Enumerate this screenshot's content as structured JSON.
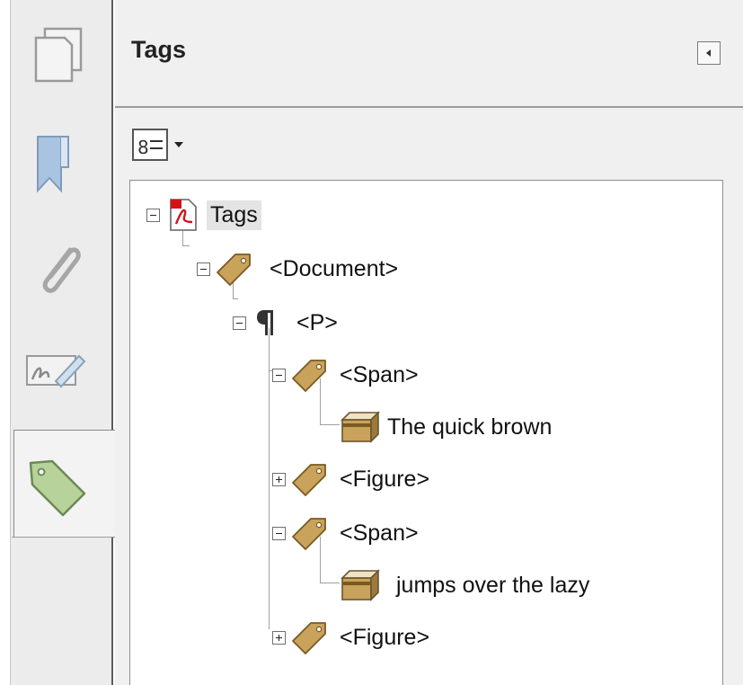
{
  "sidebar": {
    "items": [
      {
        "name": "pages",
        "icon": "pages-icon"
      },
      {
        "name": "bookmarks",
        "icon": "bookmark-icon"
      },
      {
        "name": "attachments",
        "icon": "paperclip-icon"
      },
      {
        "name": "signatures",
        "icon": "signature-icon"
      },
      {
        "name": "tags",
        "icon": "tag-icon",
        "active": true
      }
    ]
  },
  "panel": {
    "title": "Tags",
    "collapse_icon": "collapse-left-icon",
    "options_icon": "options-menu-icon"
  },
  "tree": {
    "nodes": [
      {
        "label": "Tags",
        "icon": "pdf-file-icon",
        "expander": "minus",
        "selected": true
      },
      {
        "label": "<Document>",
        "icon": "tag-icon",
        "expander": "minus"
      },
      {
        "label": "<P>",
        "icon": "paragraph-icon",
        "expander": "minus"
      },
      {
        "label": "<Span>",
        "icon": "tag-icon",
        "expander": "minus"
      },
      {
        "label": "The quick brown",
        "icon": "content-box-icon",
        "expander": "none"
      },
      {
        "label": "<Figure>",
        "icon": "tag-icon",
        "expander": "plus"
      },
      {
        "label": "<Span>",
        "icon": "tag-icon",
        "expander": "minus"
      },
      {
        "label": "jumps over the lazy",
        "icon": "content-box-icon",
        "expander": "none"
      },
      {
        "label": "<Figure>",
        "icon": "tag-icon",
        "expander": "plus"
      }
    ]
  },
  "colors": {
    "tag_fill": "#c9a25b",
    "tag_stroke": "#7a5a22",
    "pdf_red": "#d4101a",
    "active_tag_green": "#b7d39b"
  }
}
